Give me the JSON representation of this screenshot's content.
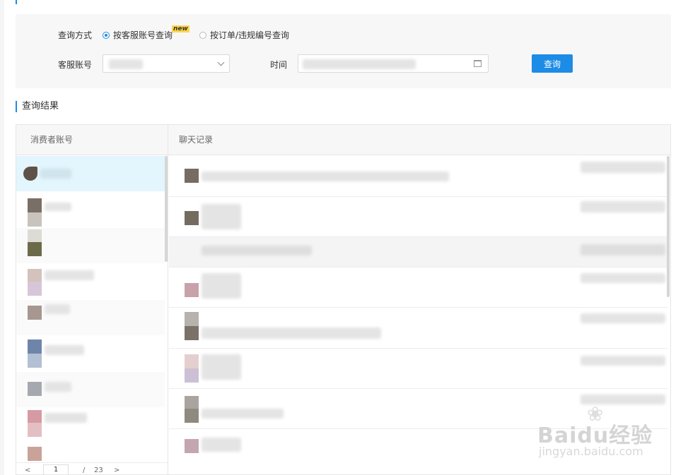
{
  "query": {
    "method_label": "查询方式",
    "options": [
      {
        "label": "按客服账号查询",
        "checked": true,
        "badge": "new"
      },
      {
        "label": "按订单/违规编号查询",
        "checked": false
      }
    ],
    "account_label": "客服账号",
    "account_value": "",
    "time_label": "时间",
    "time_value": "",
    "button_label": "查询"
  },
  "results": {
    "title": "查询结果",
    "col_consumer": "消费者账号",
    "col_chat": "聊天记录",
    "selected_row": 0,
    "row_count": 9
  },
  "pagination": {
    "prev": "<",
    "current": "1",
    "separator": "/",
    "total": "23",
    "next": ">"
  },
  "watermark": {
    "main": "Baidu经验",
    "sub": "jingyan.baidu.com"
  },
  "colors": {
    "accent": "#1c8ce6",
    "selected_row": "#e3f5fd",
    "panel_bg": "#f7f7f7"
  },
  "icons": [
    "radio-icon",
    "chevron-down-icon",
    "calendar-icon",
    "paw-icon"
  ]
}
